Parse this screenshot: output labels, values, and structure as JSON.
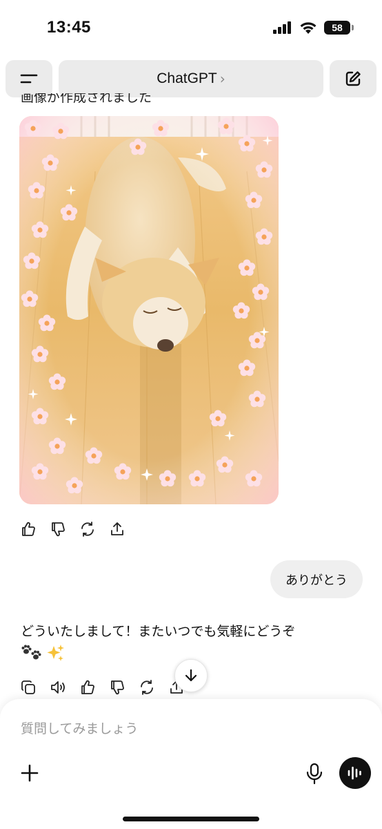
{
  "status_bar": {
    "time": "13:45",
    "battery": "58",
    "icons": [
      "signal-icon",
      "wifi-icon",
      "battery-icon"
    ]
  },
  "header": {
    "title": "ChatGPT",
    "chevron": "›",
    "icons": [
      "menu-icon",
      "compose-icon"
    ]
  },
  "conversation": {
    "cropped_text": "画像が作成されました",
    "image_alt": "generated-dog-image-with-flowers",
    "user_message": "ありがとう",
    "assistant_message": "どういたしまして！またいつでも気軽にどうぞ",
    "assistant_emojis": [
      "paw-prints-emoji",
      "sparkles-emoji"
    ]
  },
  "image_actions": [
    "thumbs-up-icon",
    "thumbs-down-icon",
    "regenerate-icon",
    "share-icon"
  ],
  "message_actions": [
    "copy-icon",
    "read-aloud-icon",
    "thumbs-up-icon",
    "thumbs-down-icon",
    "regenerate-icon",
    "share-icon"
  ],
  "composer": {
    "placeholder": "質問してみましょう",
    "icons": [
      "plus-icon",
      "microphone-icon",
      "voice-mode-icon"
    ]
  },
  "colors": {
    "button_bg": "#ebebeb",
    "bubble_bg": "#efefef",
    "placeholder": "#9a9a9a",
    "voice_button": "#111111"
  }
}
